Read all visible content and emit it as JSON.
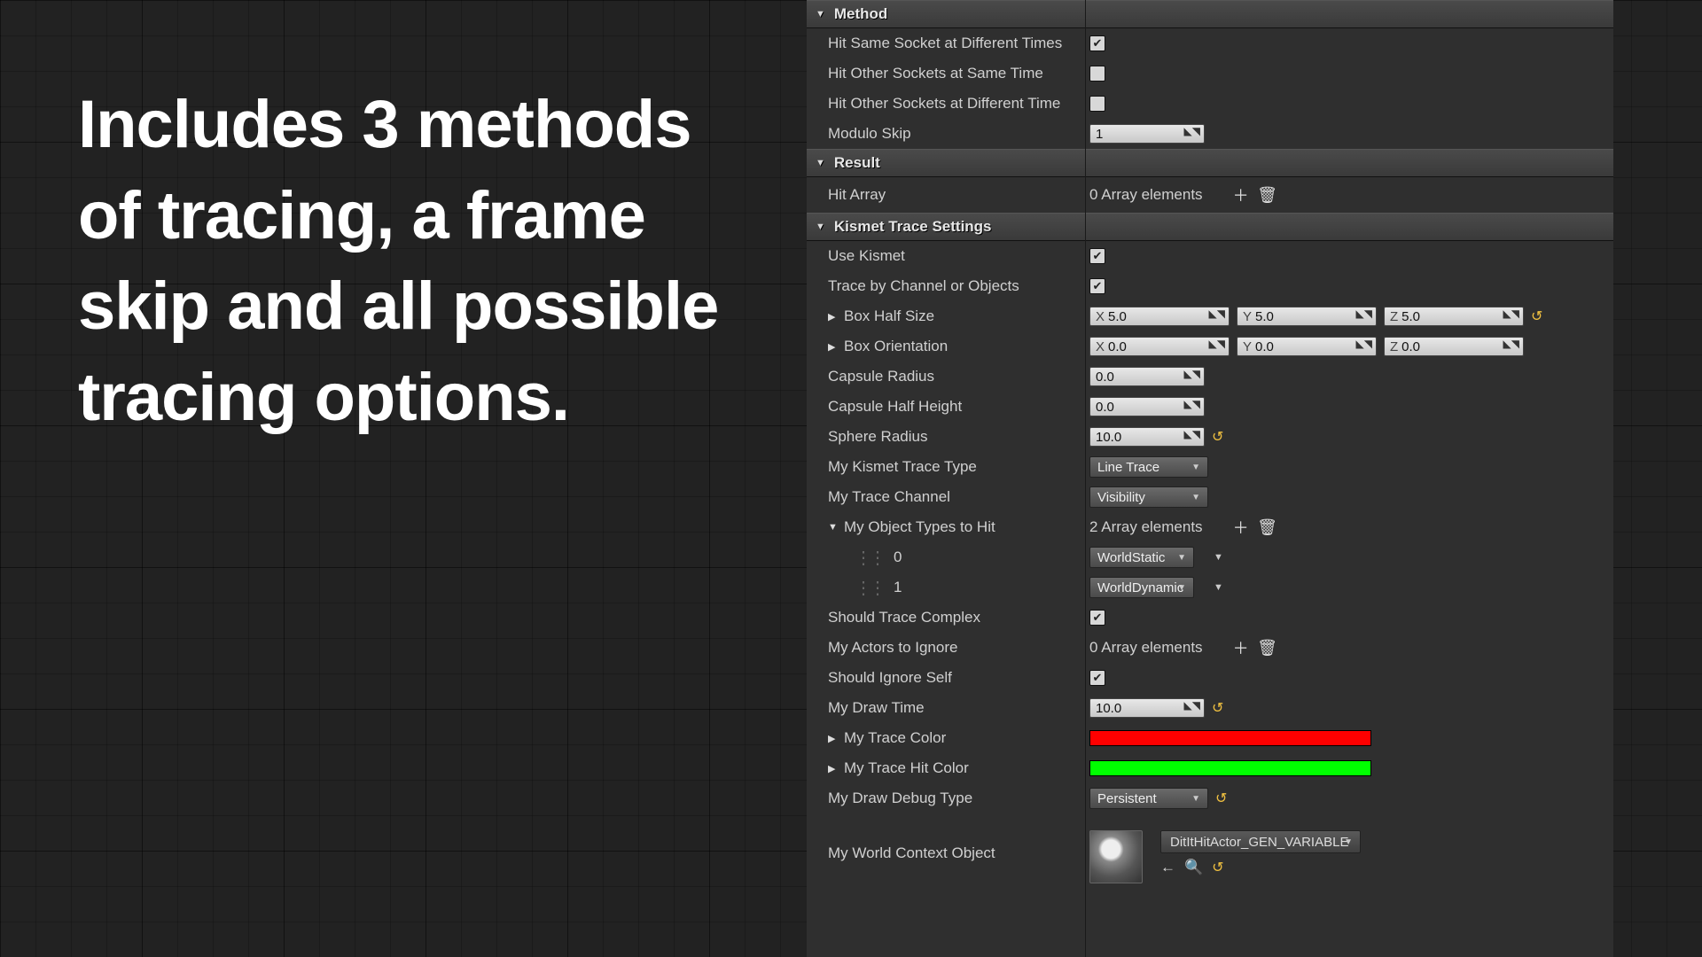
{
  "marketing_text": "Includes 3 methods of tracing, a frame skip and all possible tracing options.",
  "sections": {
    "method": {
      "title": "Method",
      "hit_same_socket_diff_times_label": "Hit Same Socket at Different Times",
      "hit_other_sockets_same_time_label": "Hit Other Sockets at Same Time",
      "hit_other_sockets_diff_time_label": "Hit Other Sockets at Different Time",
      "modulo_skip_label": "Modulo Skip",
      "modulo_skip_value": "1",
      "hit_same_socket_diff_times_checked": true,
      "hit_other_sockets_same_time_checked": false,
      "hit_other_sockets_diff_time_checked": false
    },
    "result": {
      "title": "Result",
      "hit_array_label": "Hit Array",
      "hit_array_count": "0 Array elements"
    },
    "kismet": {
      "title": "Kismet Trace Settings",
      "use_kismet_label": "Use Kismet",
      "use_kismet_checked": true,
      "trace_by_channel_label": "Trace by Channel or Objects",
      "trace_by_channel_checked": true,
      "box_half_size_label": "Box Half Size",
      "box_half_size_x": "5.0",
      "box_half_size_y": "5.0",
      "box_half_size_z": "5.0",
      "box_orientation_label": "Box Orientation",
      "box_orientation_x": "0.0",
      "box_orientation_y": "0.0",
      "box_orientation_z": "0.0",
      "capsule_radius_label": "Capsule Radius",
      "capsule_radius_value": "0.0",
      "capsule_half_height_label": "Capsule Half Height",
      "capsule_half_height_value": "0.0",
      "sphere_radius_label": "Sphere Radius",
      "sphere_radius_value": "10.0",
      "kismet_trace_type_label": "My Kismet Trace Type",
      "kismet_trace_type_value": "Line Trace",
      "trace_channel_label": "My Trace Channel",
      "trace_channel_value": "Visibility",
      "object_types_label": "My Object Types to Hit",
      "object_types_count": "2 Array elements",
      "object_type_0_index": "0",
      "object_type_0_value": "WorldStatic",
      "object_type_1_index": "1",
      "object_type_1_value": "WorldDynamic",
      "should_trace_complex_label": "Should Trace Complex",
      "should_trace_complex_checked": true,
      "actors_to_ignore_label": "My Actors to Ignore",
      "actors_to_ignore_count": "0 Array elements",
      "should_ignore_self_label": "Should Ignore Self",
      "should_ignore_self_checked": true,
      "draw_time_label": "My Draw Time",
      "draw_time_value": "10.0",
      "trace_color_label": "My Trace Color",
      "trace_color_value": "#ff0000",
      "trace_hit_color_label": "My Trace Hit Color",
      "trace_hit_color_value": "#00ff00",
      "draw_debug_type_label": "My Draw Debug Type",
      "draw_debug_type_value": "Persistent",
      "world_context_label": "My World Context Object",
      "world_context_value": "DitItHitActor_GEN_VARIABLE"
    }
  }
}
